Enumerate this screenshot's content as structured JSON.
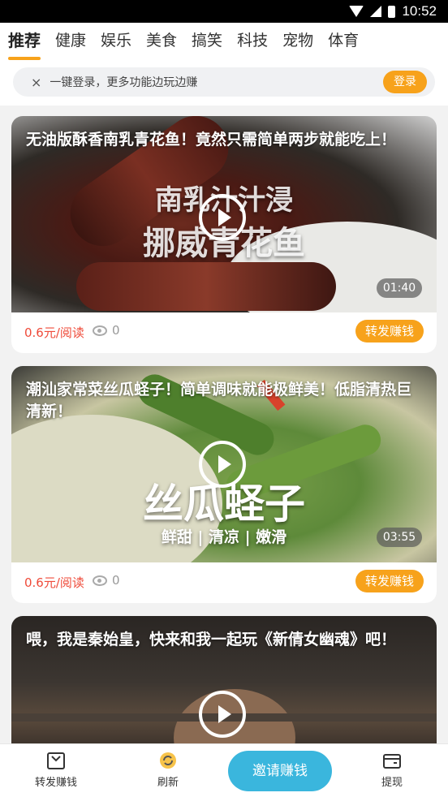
{
  "status_bar": {
    "time": "10:52"
  },
  "tabs": [
    {
      "label": "推荐",
      "active": true
    },
    {
      "label": "健康"
    },
    {
      "label": "娱乐"
    },
    {
      "label": "美食"
    },
    {
      "label": "搞笑"
    },
    {
      "label": "科技"
    },
    {
      "label": "宠物"
    },
    {
      "label": "体育"
    }
  ],
  "login_banner": {
    "close": "×",
    "text": "一键登录，更多功能边玩边赚",
    "button": "登录"
  },
  "cards": [
    {
      "title": "无油版酥香南乳青花鱼！竟然只需简单两步就能吃上！",
      "overlay_line1": "南乳汁汁浸",
      "overlay_line2": "挪威青花鱼",
      "duration": "01:40",
      "price": "0.6元/阅读",
      "views": "0",
      "share": "转发赚钱"
    },
    {
      "title": "潮汕家常菜丝瓜蛏子！简单调味就能极鲜美！低脂清热巨清新！",
      "overlay_line1": "丝瓜蛏子",
      "overlay_line2": "鲜甜 | 清凉 | 嫩滑",
      "duration": "03:55",
      "price": "0.6元/阅读",
      "views": "0",
      "share": "转发赚钱"
    },
    {
      "title": "喂，我是秦始皇，快来和我一起玩《新倩女幽魂》吧！"
    }
  ],
  "bottom_nav": {
    "share": "转发赚钱",
    "refresh": "刷新",
    "invite": "邀请赚钱",
    "withdraw": "提现"
  }
}
